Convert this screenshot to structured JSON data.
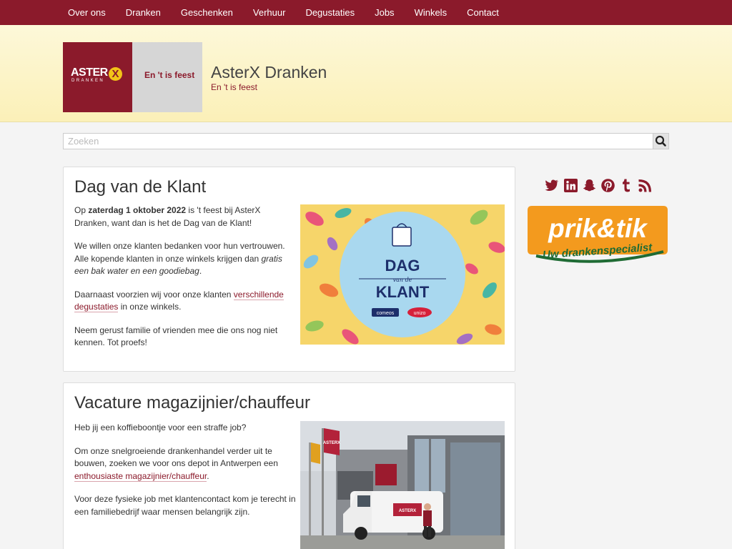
{
  "nav": {
    "items": [
      "Over ons",
      "Dranken",
      "Geschenken",
      "Verhuur",
      "Degustaties",
      "Jobs",
      "Winkels",
      "Contact"
    ]
  },
  "logo": {
    "word": "ASTER",
    "x": "X",
    "sub": "DRANKEN",
    "tagline": "En 't is feest"
  },
  "site": {
    "title": "AsterX Dranken",
    "tagline": "En 't is feest"
  },
  "search": {
    "placeholder": "Zoeken"
  },
  "posts": [
    {
      "title": "Dag van de Klant",
      "p1_pre": "Op ",
      "p1_bold": "zaterdag 1 oktober 2022",
      "p1_post": " is 't feest bij AsterX Dranken, want dan is het de Dag van de Klant!",
      "p2_pre": "We willen onze klanten bedanken voor hun vertrouwen. Alle kopende klanten in onze winkels krijgen dan ",
      "p2_em": "gratis een bak water en een goodiebag",
      "p2_post": ".",
      "p3_pre": "Daarnaast voorzien wij voor onze klanten ",
      "p3_link": "verschillende degustaties",
      "p3_post": " in onze winkels.",
      "p4": "Neem gerust familie of vrienden mee die ons nog niet kennen. Tot proefs!",
      "image": {
        "line1": "DAG",
        "line2": "van de",
        "line3": "KLANT",
        "logo1": "comeos",
        "logo2": "unizo"
      }
    },
    {
      "title": "Vacature magazijnier/chauffeur",
      "p1": "Heb jij een koffieboontje voor een straffe job?",
      "p2_pre": "Om onze snelgroeiende drankenhandel verder uit te bouwen, zoeken we voor ons depot in Antwerpen een ",
      "p2_link": "enthousiaste magazijnier/chauffeur",
      "p2_post": ".",
      "p3": "Voor deze fysieke job met klantencontact kom je terecht in een familiebedrijf waar mensen belangrijk zijn.",
      "image": {
        "sign": "ASTERX",
        "van": "ASTERX"
      }
    }
  ],
  "sidebar": {
    "social_icons": [
      "twitter-icon",
      "linkedin-icon",
      "snapchat-icon",
      "pinterest-icon",
      "tumblr-icon",
      "rss-icon"
    ],
    "promo": {
      "line1": "prik&tik",
      "line2": "Uw drankenspecialist"
    }
  },
  "colors": {
    "brand": "#8b1a2b",
    "accent_yellow": "#f2c318",
    "header_bg": "#fbf0b8",
    "promo_orange": "#f39a1e",
    "promo_green": "#1f6b34"
  }
}
